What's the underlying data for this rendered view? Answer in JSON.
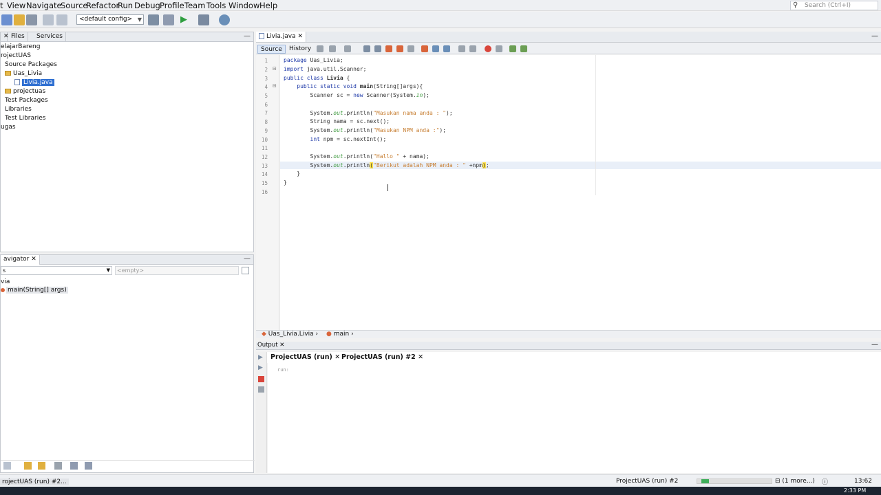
{
  "menu": [
    "t",
    "View",
    "Navigate",
    "Source",
    "Refactor",
    "Run",
    "Debug",
    "Profile",
    "Team",
    "Tools",
    "Window",
    "Help"
  ],
  "search": {
    "placeholder": "Search (Ctrl+I)"
  },
  "toolbar": {
    "config": "<default config>"
  },
  "projects_panel": {
    "tabs": [
      "Files",
      "Services"
    ],
    "tree": [
      {
        "label": "elajarBareng"
      },
      {
        "label": "rojectUAS"
      },
      {
        "label": "Source Packages"
      },
      {
        "label": "Uas_Livia"
      },
      {
        "label": "Livia.java",
        "selected": true
      },
      {
        "label": "projectuas"
      },
      {
        "label": "Test Packages"
      },
      {
        "label": "Libraries"
      },
      {
        "label": "Test Libraries"
      },
      {
        "label": "ugas"
      }
    ]
  },
  "navigator": {
    "title": "avigator",
    "filter_left": "s",
    "filter_right": "<empty>",
    "items": [
      "via",
      "main(String[] args)"
    ]
  },
  "editor": {
    "file_tab": "Livia.java",
    "source_tab": "Source",
    "history_tab": "History",
    "line_numbers": [
      "1",
      "2",
      "3",
      "4",
      "5",
      "6",
      "7",
      "8",
      "9",
      "10",
      "11",
      "12",
      "13",
      "14",
      "15",
      "16"
    ],
    "breadcrumb": [
      "Uas_Livia.Livia",
      "main"
    ]
  },
  "output": {
    "title": "Output",
    "tabs": [
      "ProjectUAS (run)",
      "ProjectUAS (run) #2"
    ],
    "text": "run:"
  },
  "status": {
    "left": "rojectUAS (run) #2...",
    "task": "ProjectUAS (run) #2",
    "more": "(1 more...)",
    "position": "13:62",
    "progress": 0.1
  },
  "taskbar": {
    "clock": "2:33 PM"
  },
  "colors": {
    "selection": "#2f6fd1",
    "keyword": "#1f3aa8",
    "string": "#c88035",
    "highlight": "#ffe14d"
  }
}
